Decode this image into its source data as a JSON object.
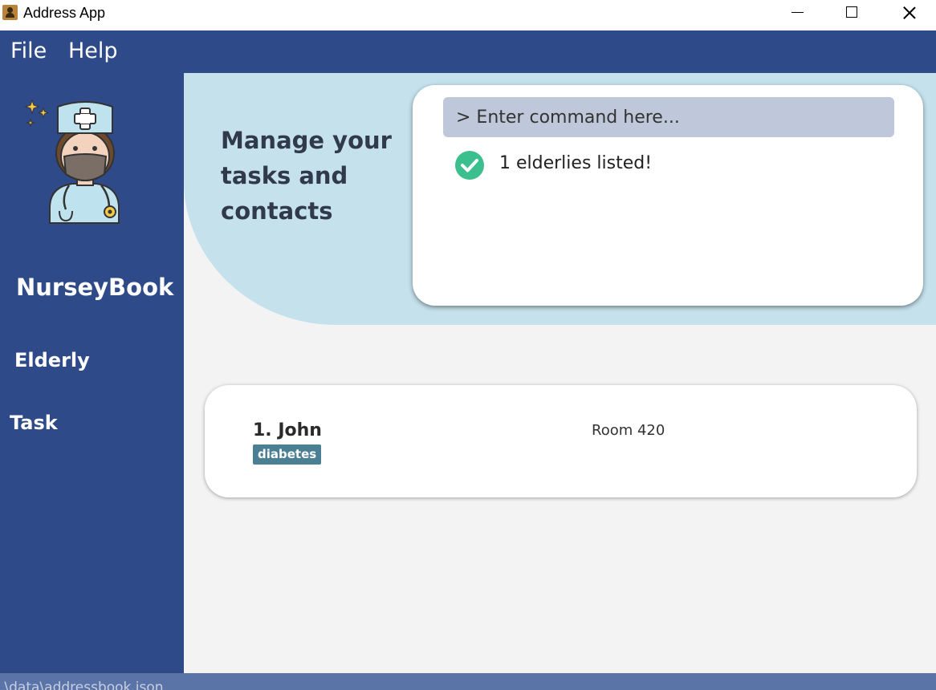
{
  "window": {
    "title": "Address App"
  },
  "menu": {
    "file_label": "File",
    "help_label": "Help"
  },
  "sidebar": {
    "app_name": "NurseyBook",
    "nav": {
      "elderly_label": "Elderly",
      "task_label": "Task"
    }
  },
  "header": {
    "tagline": "Manage your tasks and contacts",
    "command": {
      "placeholder": "> Enter command here...",
      "value": ""
    },
    "result": {
      "message": "1 elderlies listed!"
    }
  },
  "elderly_list": [
    {
      "index_name": "1. John",
      "tags": [
        "diabetes"
      ],
      "room": "Room 420"
    }
  ],
  "status_bar": {
    "path": ".\\data\\addressbook.json"
  },
  "colors": {
    "primary": "#2e4a89",
    "header_bg": "#c5e1ec",
    "input_bg": "#bfc8da",
    "tag_bg": "#4b7f93",
    "success": "#3cbf8f",
    "status_bar": "#5b74a8"
  }
}
